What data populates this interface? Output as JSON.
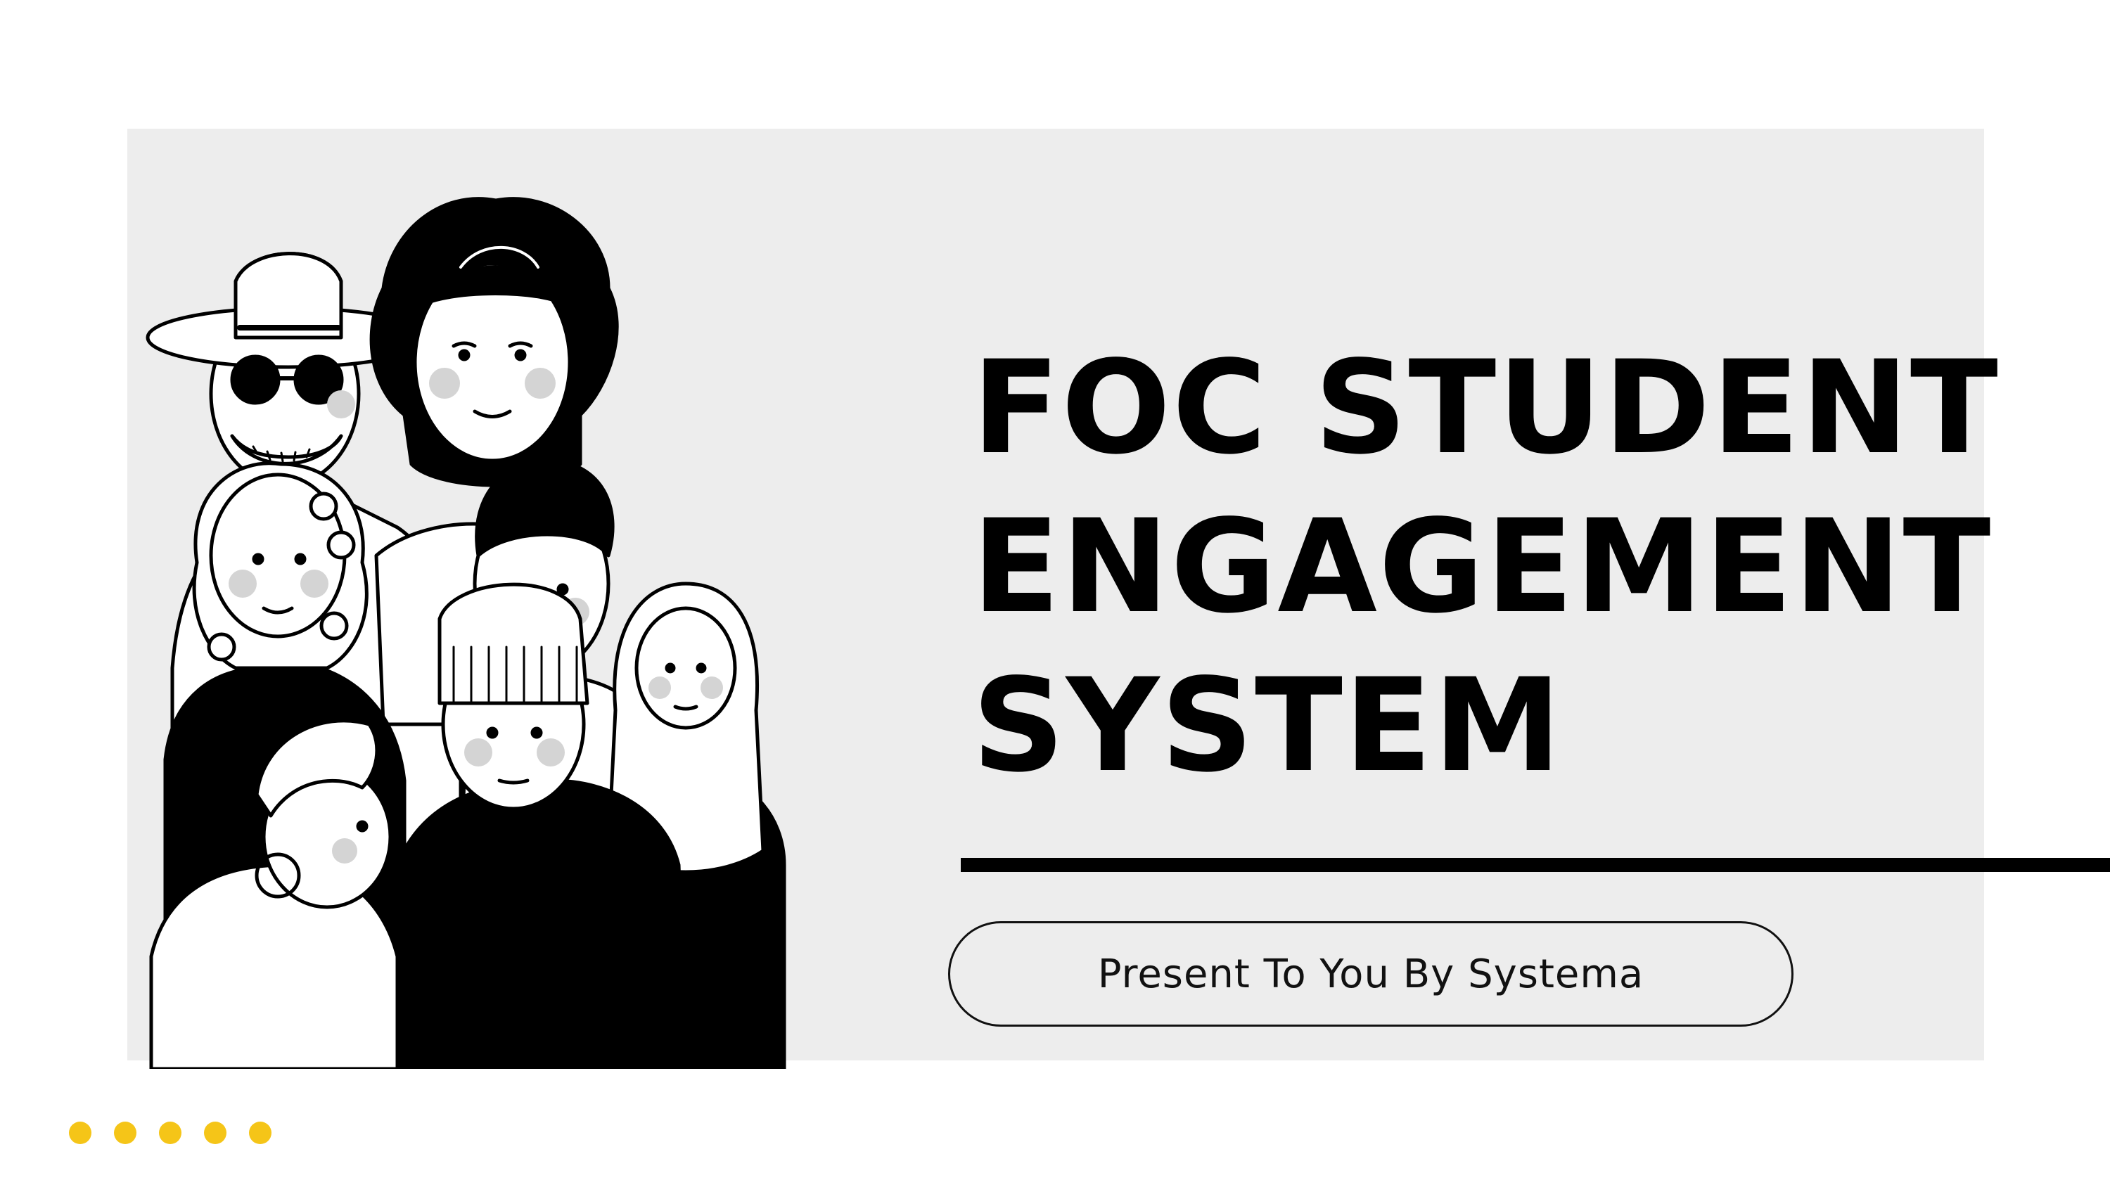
{
  "slide": {
    "title_lines": [
      "FOC STUDENT",
      "ENGAGEMENT",
      "SYSTEM"
    ],
    "subtitle": "Present To You By Systema",
    "illustration_icon": "group-of-diverse-people-line-art",
    "colors": {
      "panel": "#ededed",
      "text": "#000000",
      "accent": "#f5c518",
      "cheek": "#d4d4d4"
    },
    "decor_dot_count": 5
  }
}
